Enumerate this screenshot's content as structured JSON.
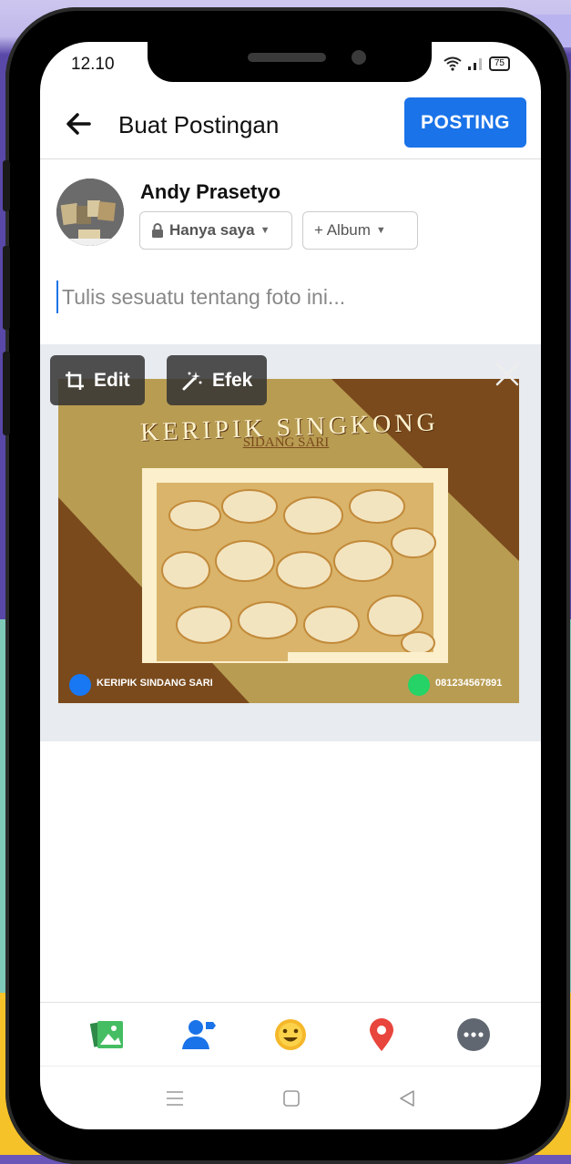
{
  "status": {
    "time": "12.10",
    "battery": "75"
  },
  "header": {
    "title": "Buat Postingan",
    "post_label": "POSTING"
  },
  "profile": {
    "name": "Andy Prasetyo",
    "privacy_label": "Hanya saya",
    "album_label": "+ Album"
  },
  "composer": {
    "placeholder": "Tulis sesuatu tentang foto ini..."
  },
  "media": {
    "edit_label": "Edit",
    "effect_label": "Efek",
    "photo": {
      "headline": "KERIPIK SINGKONG",
      "subheadline": "SIDANG SARI",
      "facebook_page": "KERIPIK SINDANG SARI",
      "phone": "081234567891"
    }
  },
  "toolbar": {
    "icons": [
      "photo-icon",
      "tag-people-icon",
      "feeling-icon",
      "location-icon",
      "more-icon"
    ]
  },
  "colors": {
    "accent": "#1a73e8",
    "photo_bg": "#b89c52",
    "photo_dark": "#7a4a1c",
    "location": "#e8453c",
    "feeling": "#f5b82a",
    "photo_icon": "#45bd62"
  }
}
